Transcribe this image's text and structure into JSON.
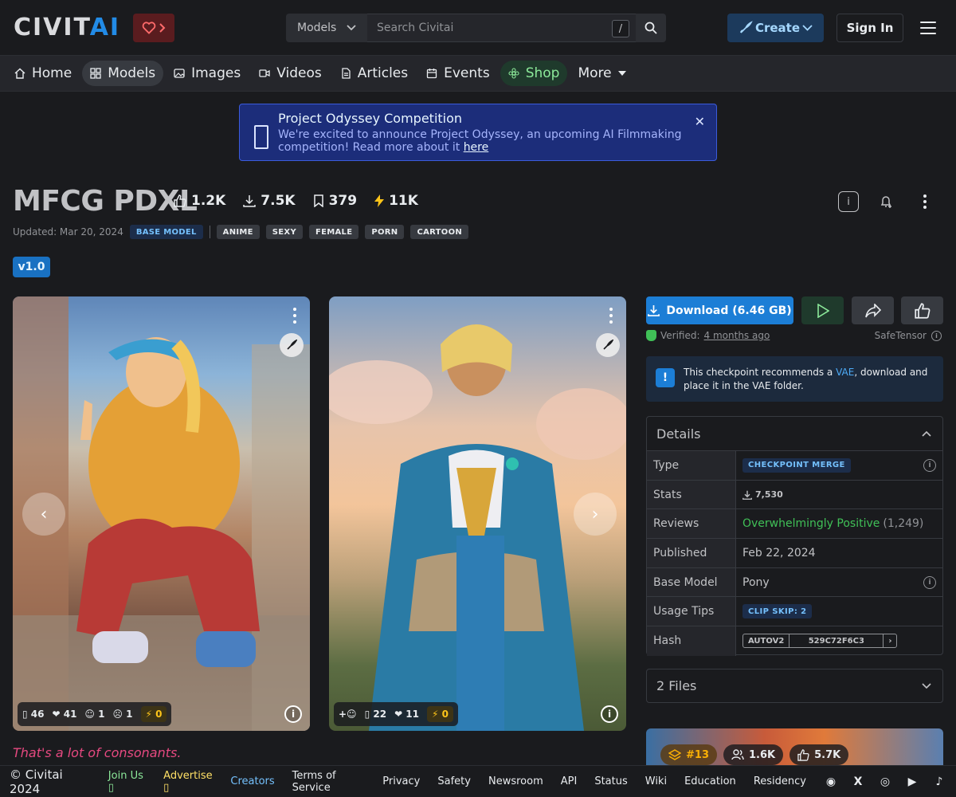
{
  "header": {
    "logo_part1": "CIVIT",
    "logo_part2": "AI",
    "search_type": "Models",
    "search_placeholder": "Search Civitai",
    "search_shortcut": "/",
    "create_label": "Create",
    "signin_label": "Sign In"
  },
  "nav": {
    "items": [
      {
        "label": "Home",
        "icon": "home-icon"
      },
      {
        "label": "Models",
        "icon": "grid-icon"
      },
      {
        "label": "Images",
        "icon": "image-icon"
      },
      {
        "label": "Videos",
        "icon": "video-icon"
      },
      {
        "label": "Articles",
        "icon": "file-icon"
      },
      {
        "label": "Events",
        "icon": "calendar-icon"
      },
      {
        "label": "Shop",
        "icon": "shop-icon"
      },
      {
        "label": "More",
        "icon": "caret-down-icon"
      }
    ]
  },
  "announcement": {
    "title": "Project Odyssey Competition",
    "body": "We're excited to announce Project Odyssey, an upcoming AI Filmmaking competition! Read more about it ",
    "link": "here"
  },
  "model": {
    "name": "MFCG PDXL",
    "stats": {
      "likes": "1.2K",
      "downloads": "7.5K",
      "collected": "379",
      "buzz": "11K"
    },
    "updated": "Updated: Mar 20, 2024",
    "base_tag": "BASE MODEL",
    "tags": [
      "ANIME",
      "SEXY",
      "FEMALE",
      "PORN",
      "CARTOON"
    ],
    "version": "v1.0"
  },
  "gallery": {
    "card1": {
      "r1": "46",
      "r2": "41",
      "r3": "1",
      "r4": "1",
      "buzz": "0"
    },
    "card2": {
      "r1": "22",
      "r2": "11",
      "buzz": "0"
    },
    "caption": "That's a lot of consonants."
  },
  "sidebar": {
    "download_label": "Download (6.46 GB)",
    "verified_label": "Verified:",
    "verified_when": "4 months ago",
    "safetensor": "SafeTensor",
    "vae_prefix": "This checkpoint recommends a ",
    "vae_link": "VAE",
    "vae_suffix": ", download and place it in the VAE folder.",
    "details_title": "Details",
    "details": {
      "type_key": "Type",
      "type_val": "CHECKPOINT MERGE",
      "stats_key": "Stats",
      "stats_val": "7,530",
      "reviews_key": "Reviews",
      "reviews_val": "Overwhelmingly Positive",
      "reviews_count": "(1,249)",
      "published_key": "Published",
      "published_val": "Feb 22, 2024",
      "base_key": "Base Model",
      "base_val": "Pony",
      "usage_key": "Usage Tips",
      "usage_val": "CLIP SKIP: 2",
      "hash_key": "Hash",
      "hash_type": "AUTOV2",
      "hash_val": "529C72F6C3"
    },
    "files_label": "2 Files",
    "promo": {
      "rank": "#13",
      "followers": "1.6K",
      "likes": "5.7K"
    }
  },
  "footer": {
    "copyright": "© Civitai 2024",
    "links": [
      "Join Us",
      "Advertise",
      "Creators",
      "Terms of Service",
      "Privacy",
      "Safety",
      "Newsroom",
      "API",
      "Status",
      "Wiki",
      "Education",
      "Residency"
    ]
  },
  "colors": {
    "accent": "#1c7ed6",
    "background": "#1a1b1e",
    "announcement": "#1c2d7a",
    "positive": "#40c057"
  }
}
